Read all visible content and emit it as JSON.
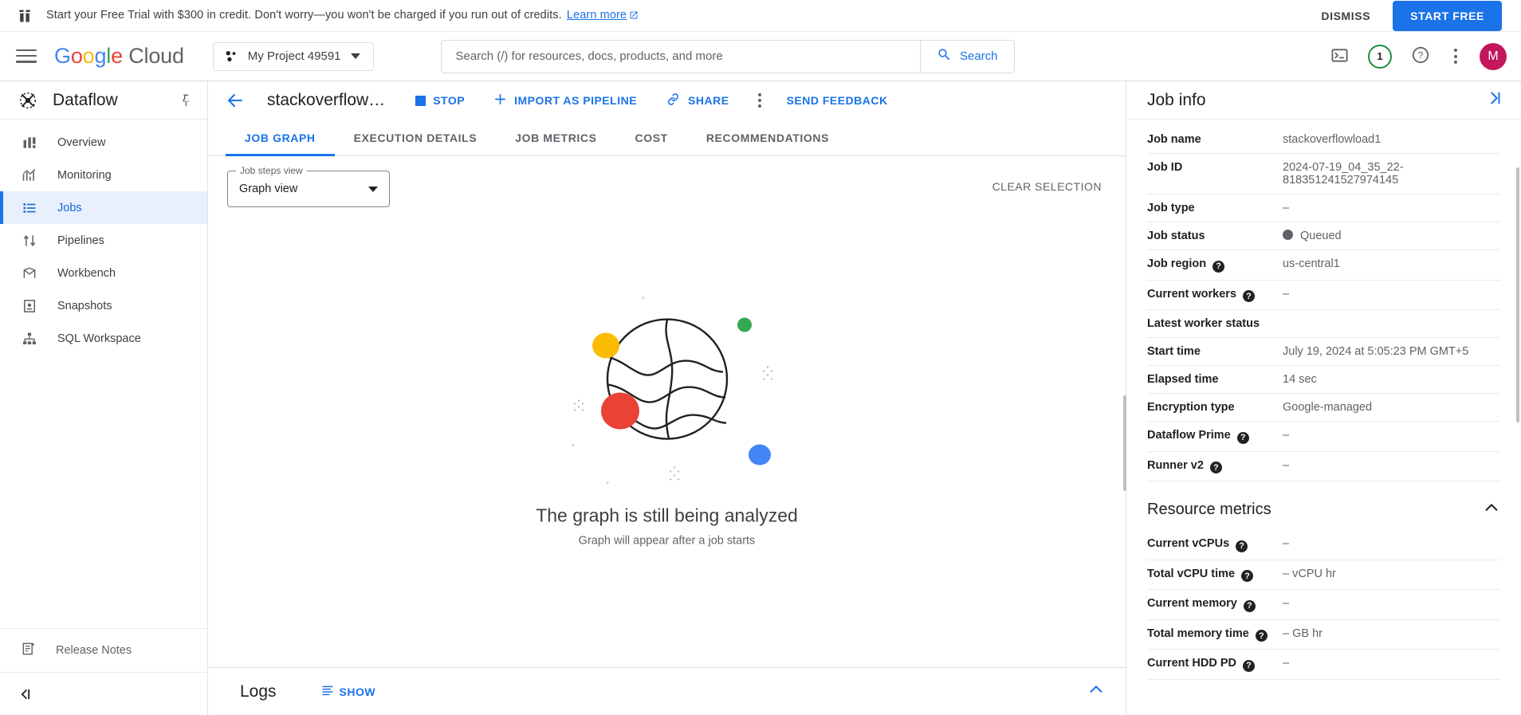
{
  "banner": {
    "icon": "gift-icon",
    "text": "Start your Free Trial with $300 in credit. Don't worry—you won't be charged if you run out of credits.",
    "link_label": "Learn more",
    "dismiss_label": "DISMISS",
    "start_free_label": "START FREE"
  },
  "header": {
    "menu_icon": "hamburger-menu-icon",
    "logo": {
      "google": "Google",
      "cloud": "Cloud"
    },
    "project": {
      "label": "My Project 49591",
      "icon": "project-dots-icon"
    },
    "search": {
      "placeholder": "Search (/) for resources, docs, products, and more",
      "value": "",
      "button_label": "Search",
      "icon": "search-icon"
    },
    "icons": {
      "cloud_shell": "terminal-icon",
      "notifications_count": "1",
      "help": "help-icon",
      "more": "kebab-menu-icon",
      "avatar_initial": "M"
    }
  },
  "sidebar": {
    "product_name": "Dataflow",
    "product_icon": "dataflow-icon",
    "pin_icon": "pin-icon",
    "items": [
      {
        "label": "Overview",
        "icon": "overview-icon",
        "active": false
      },
      {
        "label": "Monitoring",
        "icon": "monitoring-chart-icon",
        "active": false
      },
      {
        "label": "Jobs",
        "icon": "jobs-list-icon",
        "active": true
      },
      {
        "label": "Pipelines",
        "icon": "pipelines-icon",
        "active": false
      },
      {
        "label": "Workbench",
        "icon": "workbench-icon",
        "active": false
      },
      {
        "label": "Snapshots",
        "icon": "snapshots-icon",
        "active": false
      },
      {
        "label": "SQL Workspace",
        "icon": "sql-workspace-icon",
        "active": false
      }
    ],
    "release_notes": {
      "label": "Release Notes",
      "icon": "release-notes-icon"
    },
    "collapse_icon": "collapse-sidebar-icon"
  },
  "job_header": {
    "back_icon": "back-arrow-icon",
    "title": "stackoverflow…",
    "actions": [
      {
        "label": "STOP",
        "icon": "stop-square-icon"
      },
      {
        "label": "IMPORT AS PIPELINE",
        "icon": "plus-icon"
      },
      {
        "label": "SHARE",
        "icon": "share-link-icon"
      }
    ],
    "more_icon": "kebab-menu-icon",
    "send_feedback_label": "SEND FEEDBACK"
  },
  "tabs": [
    {
      "label": "JOB GRAPH",
      "active": true
    },
    {
      "label": "EXECUTION DETAILS",
      "active": false
    },
    {
      "label": "JOB METRICS",
      "active": false
    },
    {
      "label": "COST",
      "active": false
    },
    {
      "label": "RECOMMENDATIONS",
      "active": false
    }
  ],
  "graph": {
    "steps_view_legend": "Job steps view",
    "steps_view_value": "Graph view",
    "clear_selection_label": "CLEAR SELECTION",
    "empty_title": "The graph is still being analyzed",
    "empty_subtitle": "Graph will appear after a job starts",
    "illustration_colors": {
      "yellow": "#fbbc04",
      "green": "#34a853",
      "red": "#ea4335",
      "blue": "#4285f4",
      "outline": "#202124"
    }
  },
  "logs": {
    "title": "Logs",
    "show_label": "SHOW",
    "show_icon": "logs-lines-icon",
    "expand_icon": "chevron-up-icon"
  },
  "job_info": {
    "title": "Job info",
    "collapse_icon": "expand-right-icon",
    "rows": [
      {
        "key": "Job name",
        "value": "stackoverflowload1",
        "help": false
      },
      {
        "key": "Job ID",
        "value": "2024-07-19_04_35_22-818351241527974145",
        "help": false
      },
      {
        "key": "Job type",
        "value": "–",
        "help": false
      },
      {
        "key": "Job status",
        "value": "Queued",
        "help": false,
        "status_dot": true
      },
      {
        "key": "Job region",
        "value": "us-central1",
        "help": true
      },
      {
        "key": "Current workers",
        "value": "–",
        "help": true
      },
      {
        "key": "Latest worker status",
        "value": "",
        "help": false
      },
      {
        "key": "Start time",
        "value": "July 19, 2024 at 5:05:23 PM GMT+5",
        "help": false
      },
      {
        "key": "Elapsed time",
        "value": "14 sec",
        "help": false
      },
      {
        "key": "Encryption type",
        "value": "Google-managed",
        "help": false
      },
      {
        "key": "Dataflow Prime",
        "value": "–",
        "help": true
      },
      {
        "key": "Runner v2",
        "value": "–",
        "help": true
      }
    ]
  },
  "resource_metrics": {
    "title": "Resource metrics",
    "toggle_icon": "chevron-up-icon",
    "rows": [
      {
        "key": "Current vCPUs",
        "value": "–",
        "help": true
      },
      {
        "key": "Total vCPU time",
        "value": "– vCPU hr",
        "help": true
      },
      {
        "key": "Current memory",
        "value": "–",
        "help": true
      },
      {
        "key": "Total memory time",
        "value": "– GB hr",
        "help": true
      },
      {
        "key": "Current HDD PD",
        "value": "–",
        "help": true
      }
    ]
  }
}
